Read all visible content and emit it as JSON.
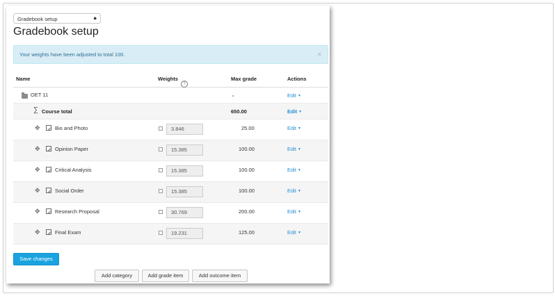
{
  "selector": {
    "value": "Gradebook setup"
  },
  "page_title": "Gradebook setup",
  "alert": {
    "message": "Your weights have been adjusted to total 100.",
    "close": "×"
  },
  "table": {
    "headers": {
      "name": "Name",
      "weights": "Weights",
      "max_grade": "Max grade",
      "actions": "Actions"
    },
    "category": {
      "name": "OET 11",
      "max_grade": "-",
      "action": "Edit"
    },
    "total": {
      "name": "Course total",
      "max_grade": "650.00",
      "action": "Edit"
    },
    "items": [
      {
        "name": "Bio and Photo",
        "weight": "3.846",
        "max_grade": "25.00",
        "action": "Edit"
      },
      {
        "name": "Opinion Paper",
        "weight": "15.385",
        "max_grade": "100.00",
        "action": "Edit"
      },
      {
        "name": "Critical Analysis",
        "weight": "15.385",
        "max_grade": "100.00",
        "action": "Edit"
      },
      {
        "name": "Social Order",
        "weight": "15.385",
        "max_grade": "100.00",
        "action": "Edit"
      },
      {
        "name": "Research Proposal",
        "weight": "30.769",
        "max_grade": "200.00",
        "action": "Edit"
      },
      {
        "name": "Final Exam",
        "weight": "19.231",
        "max_grade": "125.00",
        "action": "Edit"
      }
    ]
  },
  "buttons": {
    "save": "Save changes",
    "add_category": "Add category",
    "add_grade_item": "Add grade item",
    "add_outcome_item": "Add outcome item"
  }
}
